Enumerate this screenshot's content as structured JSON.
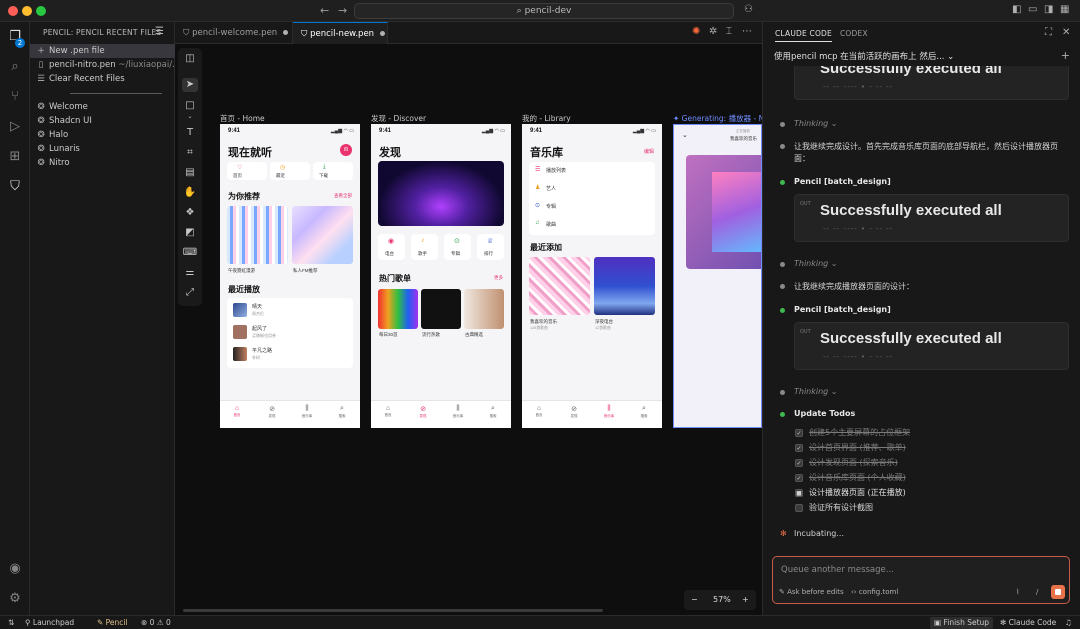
{
  "window": {
    "command_center": "pencil-dev"
  },
  "activity_bar": {
    "explorer_badge": "2"
  },
  "sidebar": {
    "title": "PENCIL: PENCIL RECENT FILES",
    "actions": [
      {
        "label": "New .pen file",
        "icon": "plus-icon"
      },
      {
        "label": "pencil-nitro.pen",
        "sub": "~/liuxiaopai/...",
        "icon": "file-icon"
      },
      {
        "label": "Clear Recent Files",
        "icon": "list-icon"
      }
    ],
    "templates": [
      {
        "label": "Welcome"
      },
      {
        "label": "Shadcn UI"
      },
      {
        "label": "Halo"
      },
      {
        "label": "Lunaris"
      },
      {
        "label": "Nitro"
      }
    ]
  },
  "tabs": [
    {
      "label": "pencil-welcome.pen"
    },
    {
      "label": "pencil-new.pen"
    }
  ],
  "canvas": {
    "zoom": "57%",
    "frames": [
      {
        "label": "首页 - Home"
      },
      {
        "label": "发现 - Discover"
      },
      {
        "label": "我的 - Library"
      },
      {
        "label": "Generating: 播放器 - No"
      }
    ],
    "home": {
      "time": "9:41",
      "title": "现在就听",
      "quick": [
        "首页",
        "最近",
        "下载"
      ],
      "rec_title": "为你推荐",
      "rec_more": "查看全部",
      "rec_items": [
        "午夜霓虹漫游",
        "私人FM推荐"
      ],
      "recent_title": "最近播放",
      "recent": [
        {
          "title": "晴天",
          "artist": "周杰伦"
        },
        {
          "title": "起风了",
          "artist": "买辣椒也用券"
        },
        {
          "title": "平凡之路",
          "artist": "朴树"
        }
      ],
      "tabbar": [
        "首页",
        "发现",
        "音乐库",
        "搜索"
      ]
    },
    "discover": {
      "time": "9:41",
      "title": "发现",
      "cats": [
        "电台",
        "歌手",
        "专辑",
        "排行"
      ],
      "hot_title": "热门歌单",
      "hot_more": "更多",
      "hot_items": [
        "每日30首",
        "流行热歌",
        "古典精选"
      ],
      "tabbar": [
        "首页",
        "发现",
        "音乐库",
        "搜索"
      ]
    },
    "library": {
      "time": "9:41",
      "title": "音乐库",
      "edit": "编辑",
      "list": [
        "播放列表",
        "艺人",
        "专辑",
        "歌曲"
      ],
      "recent_title": "最近添加",
      "recent": [
        {
          "title": "我喜欢的音乐",
          "sub": "128首歌曲"
        },
        {
          "title": "深夜电台",
          "sub": "12首歌曲"
        }
      ],
      "tabbar": [
        "首页",
        "发现",
        "音乐库",
        "搜索"
      ]
    },
    "player": {
      "header_small": "正在播放",
      "header": "我喜欢的音乐"
    }
  },
  "panel": {
    "tabs": [
      "CLAUDE CODE",
      "CODEX"
    ],
    "session": "使用pencil mcp 在当前活跃的画布上 然后...",
    "messages": {
      "out_label": "OUT",
      "out_text": "Successfully executed all",
      "out_dashes": "-- -- ---- • - -- --",
      "thinking": "Thinking",
      "msg1": "让我继续完成设计。首先完成音乐库页面的底部导航栏，然后设计播放器页面：",
      "tool1": "Pencil [batch_design]",
      "msg2": "让我继续完成播放器页面的设计：",
      "tool2": "Pencil [batch_design]",
      "todos_title": "Update Todos",
      "todos": [
        {
          "label": "创建5个主要屏幕的占位框架",
          "state": "done"
        },
        {
          "label": "设计首页界面 (推荐、歌单)",
          "state": "done"
        },
        {
          "label": "设计发现页面 (探索音乐)",
          "state": "done"
        },
        {
          "label": "设计音乐库页面 (个人收藏)",
          "state": "done"
        },
        {
          "label": "设计播放器页面 (正在播放)",
          "state": "current"
        },
        {
          "label": "验证所有设计截图",
          "state": "pending"
        }
      ],
      "incubating": "Incubating..."
    },
    "input_placeholder": "Queue another message...",
    "ask_before_edits": "Ask before edits",
    "config": "config.toml",
    "slash": "/"
  },
  "statusbar": {
    "launchpad": "Launchpad",
    "pencil": "Pencil",
    "errors": "0",
    "warnings": "0",
    "finish_setup": "Finish Setup",
    "claude_code": "Claude Code"
  }
}
